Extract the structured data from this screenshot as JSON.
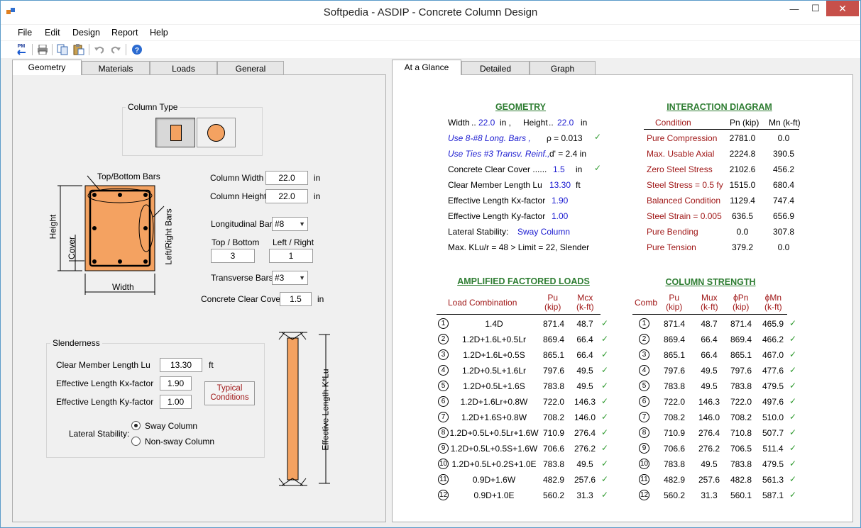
{
  "window": {
    "title": "Softpedia - ASDIP - Concrete Column Design",
    "minimize": "—",
    "maximize": "☐",
    "close": "✕"
  },
  "menu": [
    "File",
    "Edit",
    "Design",
    "Report",
    "Help"
  ],
  "toolbar": {
    "icons": [
      "pm-icon",
      "print-icon",
      "copy-icon",
      "paste-icon",
      "undo-icon",
      "redo-icon",
      "help-icon"
    ],
    "pm_label": "PM"
  },
  "left_tabs": [
    "Geometry",
    "Materials",
    "Loads",
    "General"
  ],
  "right_tabs": [
    "At a Glance",
    "Detailed",
    "Graph"
  ],
  "geometry": {
    "column_type_label": "Column Type",
    "diagram": {
      "top_bottom_bars": "Top/Bottom Bars",
      "left_right_bars": "Left/Right Bars",
      "height": "Height",
      "cover": "Cover",
      "width": "Width"
    },
    "column_width_label": "Column Width",
    "column_width": "22.0",
    "column_width_unit": "in",
    "column_height_label": "Column Height",
    "column_height": "22.0",
    "column_height_unit": "in",
    "longitudinal_bars_label": "Longitudinal Bars",
    "longitudinal_bars": "#8",
    "top_bottom_label": "Top / Bottom",
    "top_bottom": "3",
    "left_right_label": "Left / Right",
    "left_right": "1",
    "transverse_bars_label": "Transverse Bars",
    "transverse_bars": "#3",
    "clear_cover_label": "Concrete Clear Cover",
    "clear_cover": "1.5",
    "clear_cover_unit": "in"
  },
  "slenderness": {
    "title": "Slenderness",
    "lu_label": "Clear Member Length  Lu",
    "lu": "13.30",
    "lu_unit": "ft",
    "kx_label": "Effective Length Kx-factor",
    "kx": "1.90",
    "ky_label": "Effective Length Ky-factor",
    "ky": "1.00",
    "typical_button": "Typical Conditions",
    "lateral_label": "Lateral Stability:",
    "sway": "Sway Column",
    "nonsway": "Non-sway Column",
    "effective_length_label": "Effective Length K*Lu"
  },
  "glance": {
    "geometry_header": "GEOMETRY",
    "geo": {
      "width_label": "Width",
      "width_dots": "..",
      "width_val": "22.0",
      "width_unit": "in  ,",
      "height_label": "Height",
      "height_dots": "..",
      "height_val": "22.0",
      "height_unit": "in",
      "long_bars": "Use 8-#8 Long. Bars  ,",
      "rho": "ρ = 0.013",
      "ties": "Use Ties #3 Transv. Reinf.,",
      "dprime": "d' = 2.4  in",
      "cover_label": "Concrete Clear Cover  ......",
      "cover_val": "1.5",
      "cover_unit": "in",
      "lu_label": "Clear Member Length  Lu",
      "lu_val": "13.30",
      "lu_unit": "ft",
      "kx_label": "Effective Length Kx-factor",
      "kx_val": "1.90",
      "ky_label": "Effective Length Ky-factor",
      "ky_val": "1.00",
      "lat_label": "Lateral Stability:",
      "lat_val": "Sway Column",
      "klr": "Max. KLu/r =  48  >  Limit = 22,   Slender",
      "check": "✓"
    },
    "interaction_header": "INTERACTION DIAGRAM",
    "interaction_cols": [
      "Condition",
      "Pn (kip)",
      "Mn (k-ft)"
    ],
    "interaction_rows": [
      [
        "Pure Compression",
        "2781.0",
        "0.0"
      ],
      [
        "Max. Usable Axial",
        "2224.8",
        "390.5"
      ],
      [
        "Zero Steel Stress",
        "2102.6",
        "456.2"
      ],
      [
        "Steel Stress = 0.5 fy",
        "1515.0",
        "680.4"
      ],
      [
        "Balanced Condition",
        "1129.4",
        "747.4"
      ],
      [
        "Steel Strain = 0.005",
        "636.5",
        "656.9"
      ],
      [
        "Pure Bending",
        "0.0",
        "307.8"
      ],
      [
        "Pure Tension",
        "379.2",
        "0.0"
      ]
    ],
    "loads_header": "AMPLIFIED FACTORED LOADS",
    "loads_cols": [
      "Load Combination",
      "Pu\n(kip)",
      "Mcx\n(k-ft)"
    ],
    "loads_rows": [
      [
        "1",
        "1.4D",
        "871.4",
        "48.7"
      ],
      [
        "2",
        "1.2D+1.6L+0.5Lr",
        "869.4",
        "66.4"
      ],
      [
        "3",
        "1.2D+1.6L+0.5S",
        "865.1",
        "66.4"
      ],
      [
        "4",
        "1.2D+0.5L+1.6Lr",
        "797.6",
        "49.5"
      ],
      [
        "5",
        "1.2D+0.5L+1.6S",
        "783.8",
        "49.5"
      ],
      [
        "6",
        "1.2D+1.6Lr+0.8W",
        "722.0",
        "146.3"
      ],
      [
        "7",
        "1.2D+1.6S+0.8W",
        "708.2",
        "146.0"
      ],
      [
        "8",
        "1.2D+0.5L+0.5Lr+1.6W",
        "710.9",
        "276.4"
      ],
      [
        "9",
        "1.2D+0.5L+0.5S+1.6W",
        "706.6",
        "276.2"
      ],
      [
        "10",
        "1.2D+0.5L+0.2S+1.0E",
        "783.8",
        "49.5"
      ],
      [
        "11",
        "0.9D+1.6W",
        "482.9",
        "257.6"
      ],
      [
        "12",
        "0.9D+1.0E",
        "560.2",
        "31.3"
      ]
    ],
    "strength_header": "COLUMN STRENGTH",
    "strength_cols": [
      "Comb",
      "Pu\n(kip)",
      "Mux\n(k-ft)",
      "ϕPn\n(kip)",
      "ϕMn\n(k-ft)"
    ],
    "strength_rows": [
      [
        "1",
        "871.4",
        "48.7",
        "871.4",
        "465.9"
      ],
      [
        "2",
        "869.4",
        "66.4",
        "869.4",
        "466.2"
      ],
      [
        "3",
        "865.1",
        "66.4",
        "865.1",
        "467.0"
      ],
      [
        "4",
        "797.6",
        "49.5",
        "797.6",
        "477.6"
      ],
      [
        "5",
        "783.8",
        "49.5",
        "783.8",
        "479.5"
      ],
      [
        "6",
        "722.0",
        "146.3",
        "722.0",
        "497.6"
      ],
      [
        "7",
        "708.2",
        "146.0",
        "708.2",
        "510.0"
      ],
      [
        "8",
        "710.9",
        "276.4",
        "710.8",
        "507.7"
      ],
      [
        "9",
        "706.6",
        "276.2",
        "706.5",
        "511.4"
      ],
      [
        "10",
        "783.8",
        "49.5",
        "783.8",
        "479.5"
      ],
      [
        "11",
        "482.9",
        "257.6",
        "482.8",
        "561.3"
      ],
      [
        "12",
        "560.2",
        "31.3",
        "560.1",
        "587.1"
      ]
    ]
  }
}
